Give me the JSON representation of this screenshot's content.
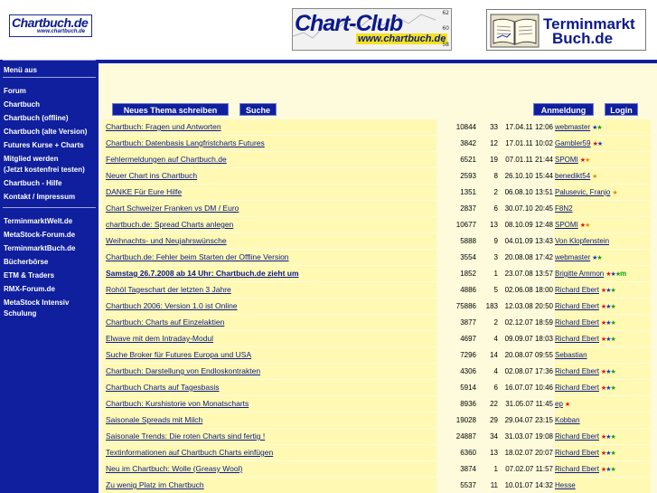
{
  "header": {
    "logo_left": {
      "main": "Chartbuch.de",
      "url": "www.chartbuch.de"
    },
    "logo_center": {
      "main": "Chart-Club",
      "url": "www.chartbuch.de",
      "ticks": [
        "62",
        "60",
        "58"
      ]
    },
    "logo_right": {
      "line1": "Terminmarkt",
      "line2": "Buch.de"
    }
  },
  "colors": {
    "sidebar": "#0f1f9e",
    "main_bg": "#fdfbdc",
    "cell_highlight": "#fff9b4",
    "link": "#0b1a8c",
    "star_red": "#e01010",
    "star_blue": "#1b33d6",
    "star_green": "#13a013",
    "star_orange": "#e08a10"
  },
  "sidebar": {
    "menu_off": "Menü aus",
    "group1": [
      "Forum",
      "Chartbuch",
      "Chartbuch (offline)",
      "Chartbuch (alte Version)",
      "Futures Kurse + Charts",
      "Mitglied werden",
      "(Jetzt kostenfrei testen)",
      "Chartbuch - Hilfe",
      "Kontakt / Impressum"
    ],
    "group2": [
      "TerminmarktWelt.de",
      "MetaStock-Forum.de",
      "TerminmarktBuch.de",
      "Bücherbörse",
      "ETM & Traders",
      "RMX-Forum.de",
      "MetaStock Intensiv",
      "Schulung"
    ]
  },
  "buttons": {
    "new_topic": "Neues Thema schreiben",
    "search": "Suche",
    "register": "Anmeldung",
    "login": "Login"
  },
  "topics": [
    {
      "title": "Chartbuch: Fragen und Antworten",
      "views": "10844",
      "replies": "33",
      "date": "17.04.11 12:06",
      "author": "webmaster",
      "stars": [
        "blue",
        "green"
      ],
      "bold": false
    },
    {
      "title": "Chartbuch: Datenbasis Langfristcharts Futures",
      "views": "3842",
      "replies": "12",
      "date": "17.01.11 10:02",
      "author": "Gambler59",
      "stars": [
        "red",
        "blue"
      ],
      "bold": false
    },
    {
      "title": "Fehlermeldungen auf Chartbuch.de",
      "views": "6521",
      "replies": "19",
      "date": "07.01.11 21:44",
      "author": "SPOMI",
      "stars": [
        "red",
        "orange"
      ],
      "bold": false
    },
    {
      "title": "Neuer Chart ins Chartbuch",
      "views": "2593",
      "replies": "8",
      "date": "26.10.10 15:44",
      "author": "benedikt54",
      "stars": [
        "orange"
      ],
      "bold": false
    },
    {
      "title": "DANKE Für Eure Hilfe",
      "views": "1351",
      "replies": "2",
      "date": "06.08.10 13:51",
      "author": "Palusevic, Franjo",
      "stars": [
        "orange"
      ],
      "bold": false
    },
    {
      "title": "Chart Schweizer Franken vs DM / Euro",
      "views": "2837",
      "replies": "6",
      "date": "30.07.10 20:45",
      "author": "F8N2",
      "stars": [],
      "bold": false
    },
    {
      "title": "chartbuch.de: Spread Charts anlegen",
      "views": "10677",
      "replies": "13",
      "date": "08.10.09 12:48",
      "author": "SPOMI",
      "stars": [
        "red",
        "orange"
      ],
      "bold": false
    },
    {
      "title": "Weihnachts- und Neujahrswünsche",
      "views": "5888",
      "replies": "9",
      "date": "04.01.09 13:43",
      "author": "Von Klopfenstein",
      "stars": [],
      "bold": false
    },
    {
      "title": "Chartbuch.de: Fehler beim Starten der Offline Version",
      "views": "3554",
      "replies": "3",
      "date": "20.08.08 17:42",
      "author": "webmaster",
      "stars": [
        "blue",
        "green"
      ],
      "bold": false
    },
    {
      "title": "Samstag 26.7.2008 ab 14 Uhr: Chartbuch.de zieht um",
      "views": "1852",
      "replies": "1",
      "date": "23.07.08 13:57",
      "author": "Brigitte Ammon",
      "stars": [
        "red",
        "blue",
        "green",
        "m"
      ],
      "bold": true
    },
    {
      "title": "Rohöl Tageschart der letzten 3 Jahre",
      "views": "4886",
      "replies": "5",
      "date": "02.06.08 18:00",
      "author": "Richard Ebert",
      "stars": [
        "red",
        "blue",
        "green"
      ],
      "bold": false
    },
    {
      "title": "Chartbuch 2006: Version 1.0 ist Online",
      "views": "75886",
      "replies": "183",
      "date": "12.03.08 20:50",
      "author": "Richard Ebert",
      "stars": [
        "red",
        "blue",
        "green"
      ],
      "bold": false
    },
    {
      "title": "Chartbuch: Charts auf Einzelaktien",
      "views": "3877",
      "replies": "2",
      "date": "02.12.07 18:59",
      "author": "Richard Ebert",
      "stars": [
        "red",
        "blue",
        "green"
      ],
      "bold": false
    },
    {
      "title": "Elwave mit dem Intraday-Modul",
      "views": "4697",
      "replies": "4",
      "date": "09.09.07 18:03",
      "author": "Richard Ebert",
      "stars": [
        "red",
        "blue",
        "green"
      ],
      "bold": false
    },
    {
      "title": "Suche Broker für Futures Europa und USA",
      "views": "7296",
      "replies": "14",
      "date": "20.08.07 09:55",
      "author": "Sebastian",
      "stars": [],
      "bold": false
    },
    {
      "title": "Chartbuch: Darstellung von Endloskontrakten",
      "views": "4306",
      "replies": "4",
      "date": "02.08.07 17:36",
      "author": "Richard Ebert",
      "stars": [
        "red",
        "blue",
        "green"
      ],
      "bold": false
    },
    {
      "title": "Chartbuch Charts auf Tagesbasis",
      "views": "5914",
      "replies": "6",
      "date": "16.07.07 10:46",
      "author": "Richard Ebert",
      "stars": [
        "red",
        "blue",
        "green"
      ],
      "bold": false
    },
    {
      "title": "Chartbuch: Kurshistorie von Monatscharts",
      "views": "8936",
      "replies": "22",
      "date": "31.05.07 11:45",
      "author": "ep",
      "stars": [
        "red"
      ],
      "bold": false
    },
    {
      "title": "Saisonale Spreads mit Milch",
      "views": "19028",
      "replies": "29",
      "date": "29.04.07 23:15",
      "author": "Kobban",
      "stars": [],
      "bold": false
    },
    {
      "title": "Saisonale Trends: Die roten Charts sind fertig !",
      "views": "24887",
      "replies": "34",
      "date": "31.03.07 19:08",
      "author": "Richard Ebert",
      "stars": [
        "red",
        "blue",
        "green"
      ],
      "bold": false
    },
    {
      "title": "Textinformationen auf Chartbuch Charts einfügen",
      "views": "6360",
      "replies": "13",
      "date": "18.02.07 20:07",
      "author": "Richard Ebert",
      "stars": [
        "red",
        "blue",
        "green"
      ],
      "bold": false
    },
    {
      "title": "Neu im Chartbuch: Wolle (Greasy Wool)",
      "views": "3874",
      "replies": "1",
      "date": "07.02.07 11:57",
      "author": "Richard Ebert",
      "stars": [
        "red",
        "blue",
        "green"
      ],
      "bold": false
    },
    {
      "title": "Zu wenig Platz im Chartbuch",
      "views": "5537",
      "replies": "11",
      "date": "10.01.07 14:32",
      "author": "Hesse",
      "stars": [],
      "bold": false
    }
  ]
}
